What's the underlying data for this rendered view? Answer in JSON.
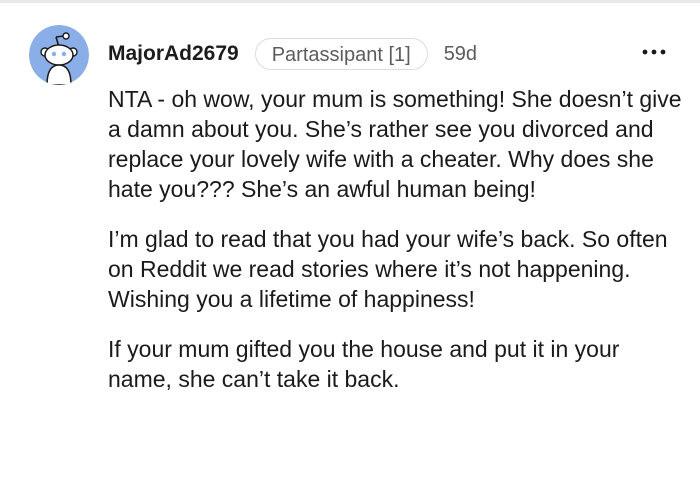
{
  "comment": {
    "avatar_icon": "reddit-snoo-avatar-icon",
    "avatar_color": "#8aaee7",
    "username": "MajorAd2679",
    "flair": "Partassipant [1]",
    "age": "59d",
    "more_icon": "more-options-icon",
    "paragraphs": [
      "NTA - oh wow, your mum is something! She doesn’t give a damn about you. She’s rather see you divorced and replace your lovely wife with a cheater. Why does she hate you??? She’s an awful human being!",
      "I’m glad to read that you had your wife’s back. So often on Reddit we read stories where it’s not happening. Wishing you a lifetime of happiness!",
      "If your mum gifted you the house and put it in your name, she can’t take it back."
    ]
  }
}
